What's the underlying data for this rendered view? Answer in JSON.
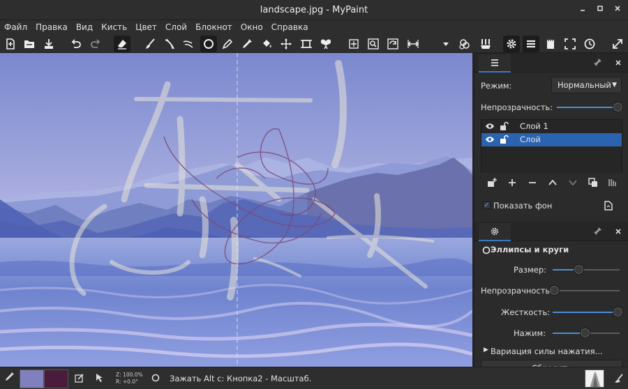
{
  "window": {
    "title": "landscape.jpg - MyPaint",
    "controls": [
      "minimize",
      "maximize",
      "close"
    ]
  },
  "menubar": {
    "items": [
      "Файл",
      "Правка",
      "Вид",
      "Кисть",
      "Цвет",
      "Слой",
      "Блокнот",
      "Окно",
      "Справка"
    ]
  },
  "toolbar": {
    "icons": [
      "new-document-icon",
      "open-icon",
      "save-icon",
      "undo-icon",
      "redo-icon",
      "eraser-icon",
      "brush-icon",
      "inking-icon",
      "smudge-icon",
      "ellipse-icon",
      "pen-icon",
      "color-picker-icon",
      "fill-icon",
      "move-icon",
      "frame-icon",
      "symmetry-icon",
      "pan-icon",
      "zoom-icon",
      "rotate-icon",
      "flip-icon",
      "dropdown-icon",
      "color-mix-icon",
      "brushes-icon",
      "settings-icon",
      "layers-icon",
      "scratchpad-icon",
      "fullscreen-icon",
      "history-icon",
      "expand-icon"
    ]
  },
  "layers_panel": {
    "tab_icon": "layers-icon",
    "mode_label": "Режим:",
    "mode_value": "Нормальный",
    "opacity_label": "Непрозрачность:",
    "opacity_value": 1.0,
    "layers": [
      {
        "name": "Слой 1",
        "visible": true,
        "locked": false,
        "selected": false
      },
      {
        "name": "Слой",
        "visible": true,
        "locked": false,
        "selected": true
      }
    ],
    "show_background_label": "Показать фон",
    "show_background_checked": true
  },
  "tool_panel": {
    "tab_icon": "gear-icon",
    "tool_name": "Эллипсы и круги",
    "size_label": "Размер:",
    "size_value": 0.25,
    "opacity_label": "Непрозрачность:",
    "opacity_value": 0.0,
    "hardness_label": "Жесткость:",
    "hardness_value": 1.0,
    "pressure_label": "Нажим:",
    "pressure_value": 0.5,
    "pressure_variation_label": "Вариация силы нажатия...",
    "reset_button": "Сбросить"
  },
  "statusbar": {
    "fg_color": "#7f80bd",
    "bg_color": "#4a1c3c",
    "zoom_line": "Z: 100.0%",
    "rotation_line": "R: +0.0°",
    "hint": "Зажать Alt с:  Кнопка2 - Масштаб."
  },
  "colors": {
    "accent": "#2a63b0",
    "slider": "#4a90d9",
    "panel_bg": "#2b2b2b"
  }
}
